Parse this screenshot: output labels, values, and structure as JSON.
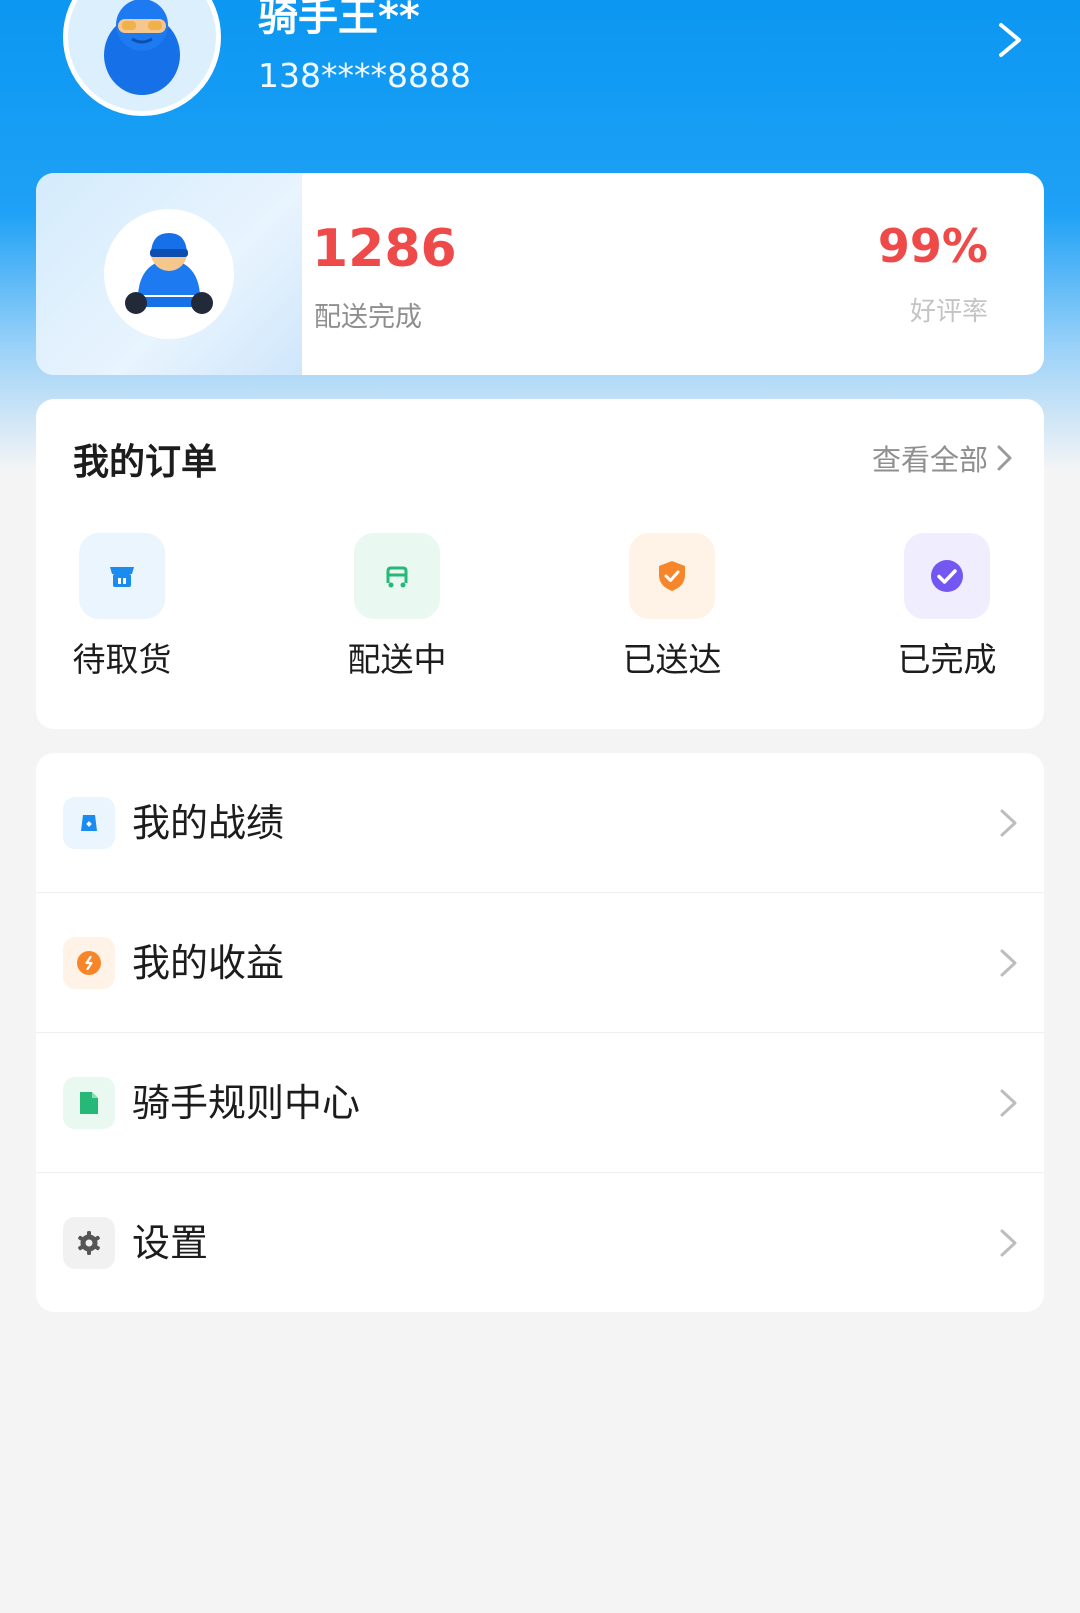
{
  "profile": {
    "name": "骑手王**",
    "phone": "138****8888"
  },
  "stats": {
    "orders_value": "1286",
    "orders_label": "配送完成",
    "rating_value": "99%",
    "rating_label": "好评率"
  },
  "orders": {
    "title": "我的订单",
    "view_all": "查看全部",
    "items": [
      {
        "label": "待取货",
        "icon": "shop-icon",
        "color": "#1a8cf0",
        "bg": "#eaf5fe"
      },
      {
        "label": "配送中",
        "icon": "delivery-cart-icon",
        "color": "#25b877",
        "bg": "#e9f8f0"
      },
      {
        "label": "已送达",
        "icon": "shield-check-icon",
        "color": "#f7862a",
        "bg": "#fff3e7"
      },
      {
        "label": "已完成",
        "icon": "check-circle-icon",
        "color": "#7357f0",
        "bg": "#f0edfe"
      }
    ]
  },
  "menu": {
    "items": [
      {
        "label": "我的战绩",
        "icon": "bag-icon",
        "color": "#1a8cf0",
        "bg": "#eaf5fe"
      },
      {
        "label": "我的收益",
        "icon": "coin-icon",
        "color": "#f7862a",
        "bg": "#fff3e7"
      },
      {
        "label": "骑手规则中心",
        "icon": "document-icon",
        "color": "#25b877",
        "bg": "#e9f8f0"
      },
      {
        "label": "设置",
        "icon": "gear-icon",
        "color": "#555555",
        "bg": "#f1f1f1"
      }
    ]
  }
}
